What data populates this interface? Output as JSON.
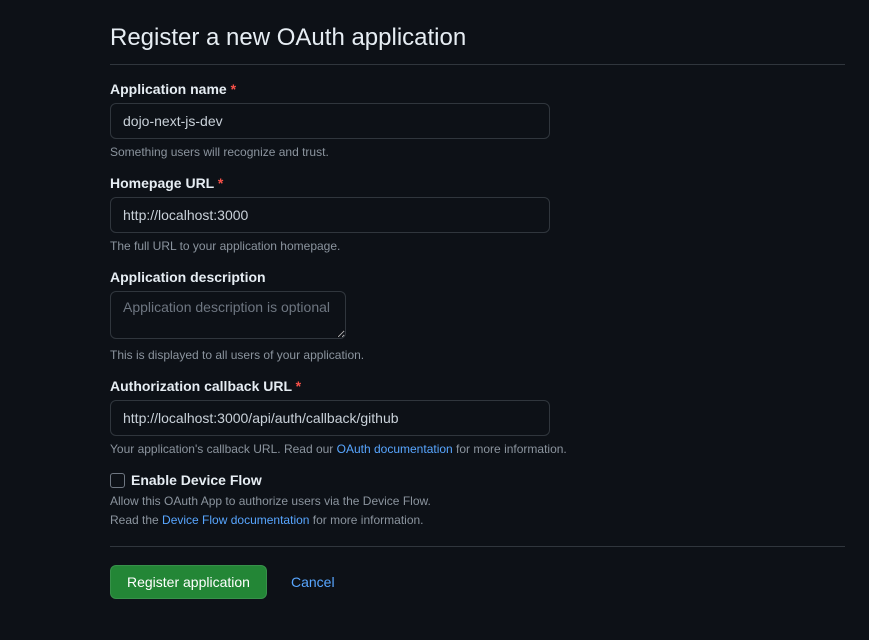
{
  "header": {
    "title": "Register a new OAuth application"
  },
  "fields": {
    "appName": {
      "label": "Application name",
      "value": "dojo-next-js-dev",
      "note": "Something users will recognize and trust."
    },
    "homepageUrl": {
      "label": "Homepage URL",
      "value": "http://localhost:3000",
      "note": "The full URL to your application homepage."
    },
    "description": {
      "label": "Application description",
      "placeholder": "Application description is optional",
      "note": "This is displayed to all users of your application."
    },
    "callbackUrl": {
      "label": "Authorization callback URL",
      "value": "http://localhost:3000/api/auth/callback/github",
      "notePrefix": "Your application's callback URL. Read our ",
      "noteLink": "OAuth documentation",
      "noteSuffix": " for more information."
    },
    "deviceFlow": {
      "label": "Enable Device Flow",
      "note1": "Allow this OAuth App to authorize users via the Device Flow.",
      "note2Prefix": "Read the ",
      "note2Link": "Device Flow documentation",
      "note2Suffix": " for more information."
    }
  },
  "actions": {
    "submit": "Register application",
    "cancel": "Cancel"
  }
}
